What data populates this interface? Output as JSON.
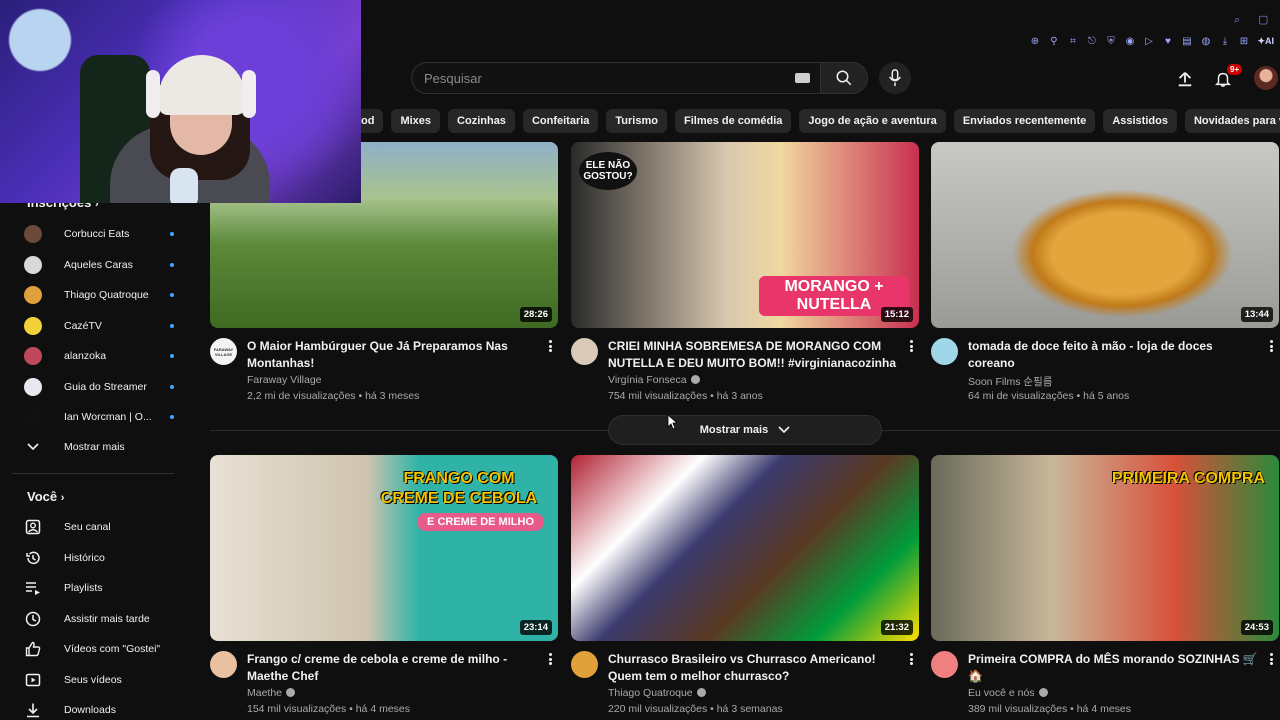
{
  "header": {
    "search_placeholder": "Pesquisar",
    "notification_count": "9+"
  },
  "chips": [
    "od",
    "Mixes",
    "Cozinhas",
    "Confeitaria",
    "Turismo",
    "Filmes de comédia",
    "Jogo de ação e aventura",
    "Enviados recentemente",
    "Assistidos",
    "Novidades para você"
  ],
  "sidebar": {
    "subscriptions_title": "Inscrições",
    "subscriptions": [
      {
        "name": "Corbucci Eats",
        "color": "#6b4a3a"
      },
      {
        "name": "Aqueles Caras",
        "color": "#d9d9d9"
      },
      {
        "name": "Thiago Quatroque",
        "color": "#e0a03a"
      },
      {
        "name": "CazéTV",
        "color": "#f2d23a"
      },
      {
        "name": "alanzoka",
        "color": "#c0485a"
      },
      {
        "name": "Guia do Streamer",
        "color": "#e8e8f0"
      },
      {
        "name": "Ian Worcman | O...",
        "color": "#111111"
      }
    ],
    "show_more": "Mostrar mais",
    "you_title": "Você",
    "you_items": [
      {
        "label": "Seu canal",
        "icon": "channel-icon"
      },
      {
        "label": "Histórico",
        "icon": "history-icon"
      },
      {
        "label": "Playlists",
        "icon": "playlists-icon"
      },
      {
        "label": "Assistir mais tarde",
        "icon": "watch-later-icon"
      },
      {
        "label": "Vídeos com \"Gostei\"",
        "icon": "like-icon"
      },
      {
        "label": "Seus vídeos",
        "icon": "your-videos-icon"
      },
      {
        "label": "Downloads",
        "icon": "download-icon"
      }
    ]
  },
  "videos": [
    {
      "title": "O Maior Hambúrguer Que Já Preparamos Nas Montanhas!",
      "channel": "Faraway Village",
      "verified": false,
      "stats": "2,2 mi de visualizações • há 3 meses",
      "duration": "28:26",
      "avatar_color": "#f4f4f4",
      "avatar_text": "FARAWAY VILLAGE"
    },
    {
      "title": "CRIEI MINHA SOBREMESA DE MORANGO COM NUTELLA E DEU MUITO BOM!! #virginianacozinha",
      "channel": "Virgínia Fonseca",
      "verified": true,
      "stats": "754 mil visualizações • há 3 anos",
      "duration": "15:12",
      "avatar_color": "#d8c9b8",
      "overlay_top": "ELE NÃO GOSTOU?",
      "overlay_bottom": "MORANGO + NUTELLA"
    },
    {
      "title": "tomada de doce feito à mão - loja de doces coreano",
      "channel": "Soon Films 순필름",
      "verified": false,
      "stats": "64 mi de visualizações • há 5 anos",
      "duration": "13:44",
      "avatar_color": "#9fd6e8"
    },
    {
      "title": "Frango c/ creme de cebola e creme de milho - Maethe Chef",
      "channel": "Maethe",
      "verified": true,
      "stats": "154 mil visualizações • há 4 meses",
      "duration": "23:14",
      "avatar_color": "#e8c2a0",
      "overlay_top": "FRANGO COM CREME DE CEBOLA",
      "overlay_bottom": "E CREME DE MILHO"
    },
    {
      "title": "Churrasco Brasileiro vs Churrasco Americano! Quem tem o melhor churrasco?",
      "channel": "Thiago Quatroque",
      "verified": true,
      "stats": "220 mil visualizações • há 3 semanas",
      "duration": "21:32",
      "avatar_color": "#e0a03a"
    },
    {
      "title": "Primeira COMPRA do MÊS morando SOZINHAS 🛒🏠",
      "channel": "Eu você e nós",
      "verified": true,
      "stats": "389 mil visualizações • há 4 meses",
      "duration": "24:53",
      "avatar_color": "#f08080",
      "overlay_top": "PRIMEIRA COMPRA"
    }
  ],
  "show_more_button": "Mostrar mais"
}
